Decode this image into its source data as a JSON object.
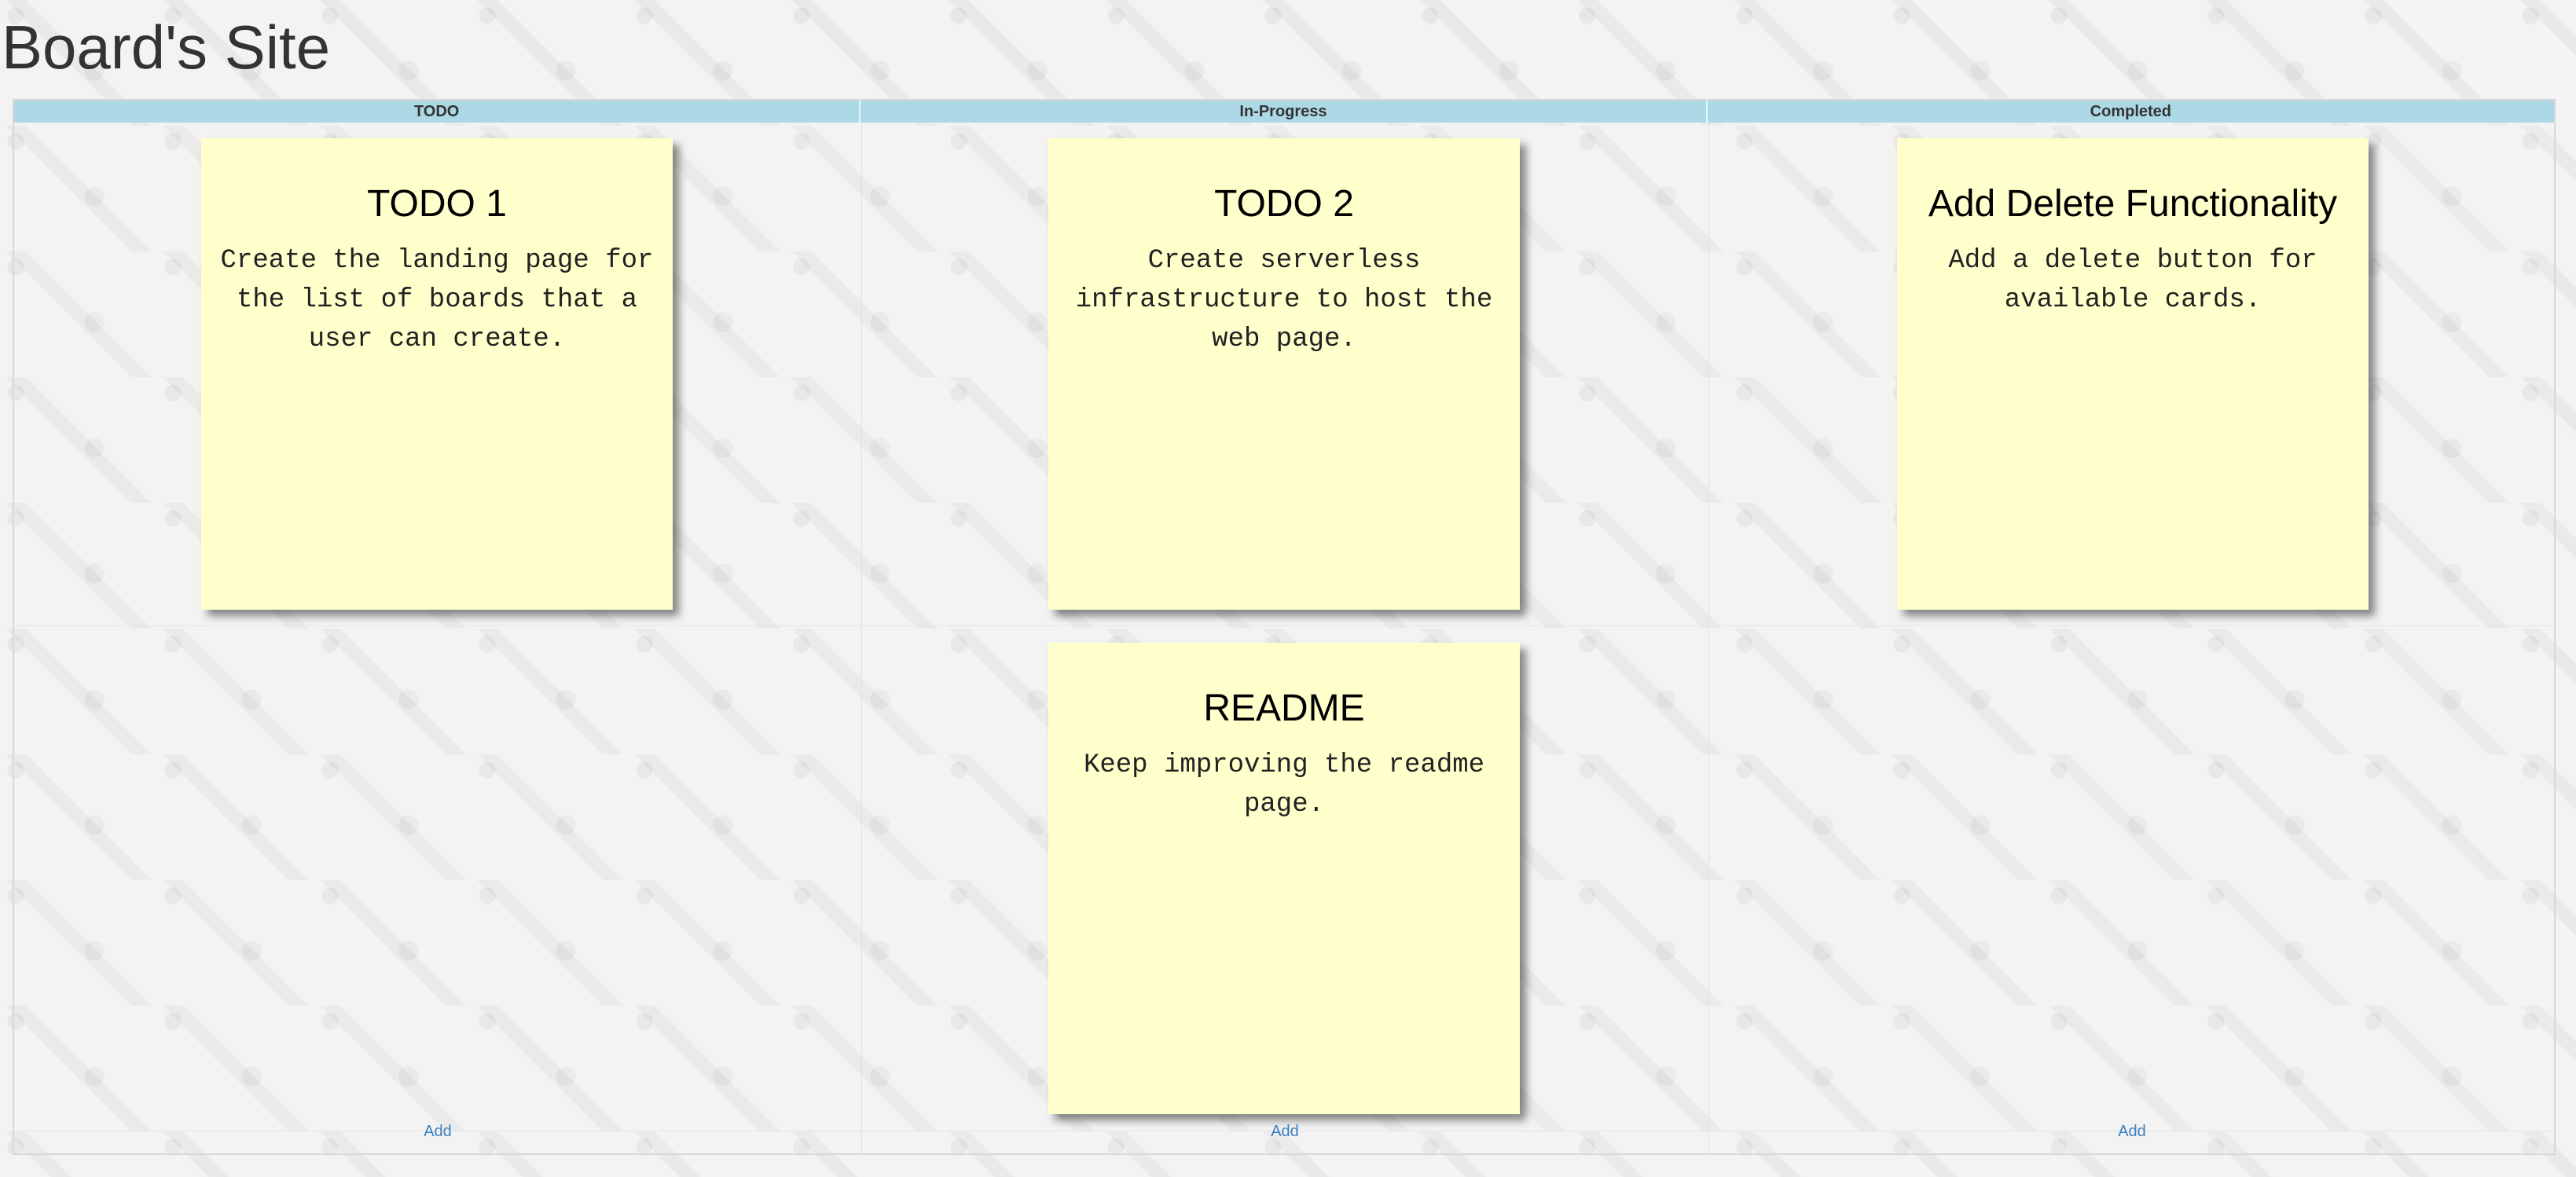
{
  "site": {
    "title": "Board's Site"
  },
  "board": {
    "columns": [
      {
        "header": "TODO",
        "add_label": "Add",
        "cards": [
          {
            "title": "TODO 1",
            "body": "Create the landing page for the list of boards that a user can create."
          }
        ]
      },
      {
        "header": "In-Progress",
        "add_label": "Add",
        "cards": [
          {
            "title": "TODO 2",
            "body": "Create serverless infrastructure to host the web page."
          },
          {
            "title": "README",
            "body": "Keep improving the readme page."
          }
        ]
      },
      {
        "header": "Completed",
        "add_label": "Add",
        "cards": [
          {
            "title": "Add Delete Functionality",
            "body": "Add a delete button for available cards."
          }
        ]
      }
    ]
  },
  "colors": {
    "header_bg": "#add8e6",
    "card_bg": "#ffffcc",
    "link": "#3b7fc4"
  }
}
